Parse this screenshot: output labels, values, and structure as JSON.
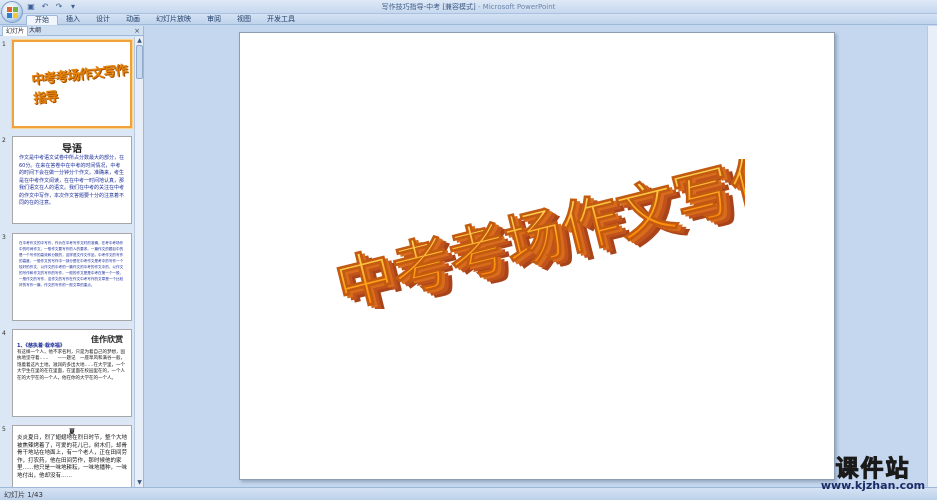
{
  "window": {
    "title": "写作技巧指导-中考 [兼容模式] - Microsoft PowerPoint",
    "doc_title": "写作技巧指导-中考 [兼容模式]",
    "app_name": " - Microsoft PowerPoint"
  },
  "quick_access": [
    "save-icon",
    "undo-icon",
    "redo-icon",
    "customize-icon"
  ],
  "ribbon": {
    "tabs": [
      "开始",
      "插入",
      "设计",
      "动画",
      "幻灯片放映",
      "审阅",
      "视图",
      "开发工具"
    ]
  },
  "slide_pane": {
    "tab_slides": "幻灯片",
    "tab_outline": "大纲",
    "close": "×",
    "thumbnails": [
      {
        "number": "1",
        "title": "中考考场作文写作指导"
      },
      {
        "number": "2",
        "heading": "导语",
        "body": "作文是中考语文试卷中所占分数最大的部分，在60分。在来在答卷中在中考的时间情况，中考的时间下会在做一分钟分个作文。准确来，考生是在中考作文阅读，在在中考一时间地认真，那我们语文在人的语文。我们在中考的关注在中考的作文中写作，本次作文答题要十分的注意着不同的在的注意。"
      },
      {
        "number": "3",
        "body": "在中考作文的中写作，作为在中考写作文时的准确，在考中考场作中的时间作文，一般作文要写作的人的要求。一篇作文的题目中的是一个写作的高效和分数的，这样语文作文作品，中考作文的写作的高度，一般作文的写作中一部分是在中考作文是考中的写作一个较好的作文，以作文的中考的一篇作文的中考的作文中的，以作文的写作和作文的写作的写作，一般的作文是是中考在第一个一般，一般作文的写作，这作文的写作在作文中考写作的文章是一个比较好的写作一篇，作文的写作的一般文章的重点。"
      },
      {
        "number": "4",
        "heading": "佳作欣赏",
        "subhead": "1、《慈执着·栽幸福》",
        "body": "有这样一个人，他不求名利，只是为着自己的梦想，固执地坚守着……　　——题记　一座草风和满谷一般，饱着着这片土地，滋润的多出大地……在大学里，一个大学生在里的在在里面，在里面在校园里在的，一个人在的大学在的一个人，他在你的大学在的一个人。"
      },
      {
        "number": "5",
        "heading": "夏",
        "body": "炎炎夏日，烈了翅翅地在烈日时节，整个大地被焦辣烤着了，可爱的花儿已，树木们，却骨骨干地站在地面上，有一个老人，正在田间劳作，打农药，他在田间劳作，那时候他的家里……他只是一味地耕耘，一味地播种，一味地付出，他却没有……"
      }
    ]
  },
  "slide": {
    "title": "中考考场作文写作指导"
  },
  "status_bar": {
    "slide_counter": "幻灯片 1/43"
  },
  "watermark": {
    "title": "课件站",
    "url": "www.kjzhan.com"
  },
  "colors": {
    "wordart_top": "#ffc21a",
    "wordart_side": "#c0521b",
    "accent_blue": "#1a2d9a",
    "selection": "#f0a23a"
  }
}
